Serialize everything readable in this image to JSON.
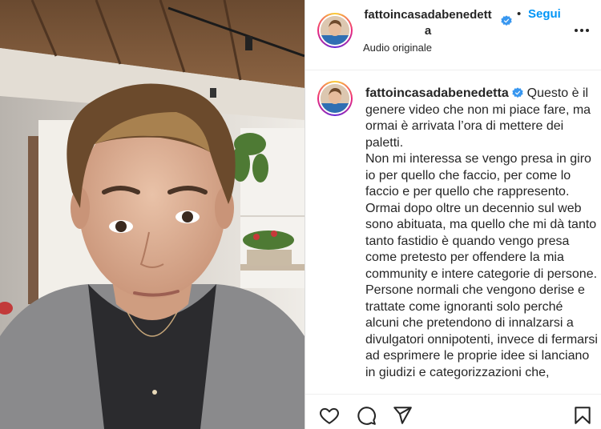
{
  "post": {
    "username": "fattoincasadabenedetta",
    "follow_label": "Segui",
    "separator": "•",
    "audio": "Audio originale"
  },
  "caption": {
    "username": "fattoincasadabenedetta",
    "first_line": " Questo è il genere video che non mi piace fare, ma ormai è arrivata l’ora di mettere dei paletti.",
    "body": "Non mi interessa se vengo presa in giro io per quello che faccio, per come lo faccio e per quello che rappresento. Ormai dopo oltre un decennio sul web sono abituata, ma quello che mi dà tanto tanto fastidio è quando vengo presa come pretesto per offendere la mia community e intere categorie di persone. Persone normali che vengono derise e trattate come ignoranti solo perché alcuni che pretendono di innalzarsi a divulgatori onnipotenti, invece di fermarsi ad esprimere le proprie idee si lanciano in giudizi e categorizzazioni che,"
  },
  "icons": {
    "verified": "verified-badge-icon",
    "more": "more-options-icon",
    "like": "heart-icon",
    "comment": "comment-icon",
    "share": "send-icon",
    "save": "bookmark-icon"
  },
  "colors": {
    "accent": "#0095f6",
    "text": "#262626"
  }
}
